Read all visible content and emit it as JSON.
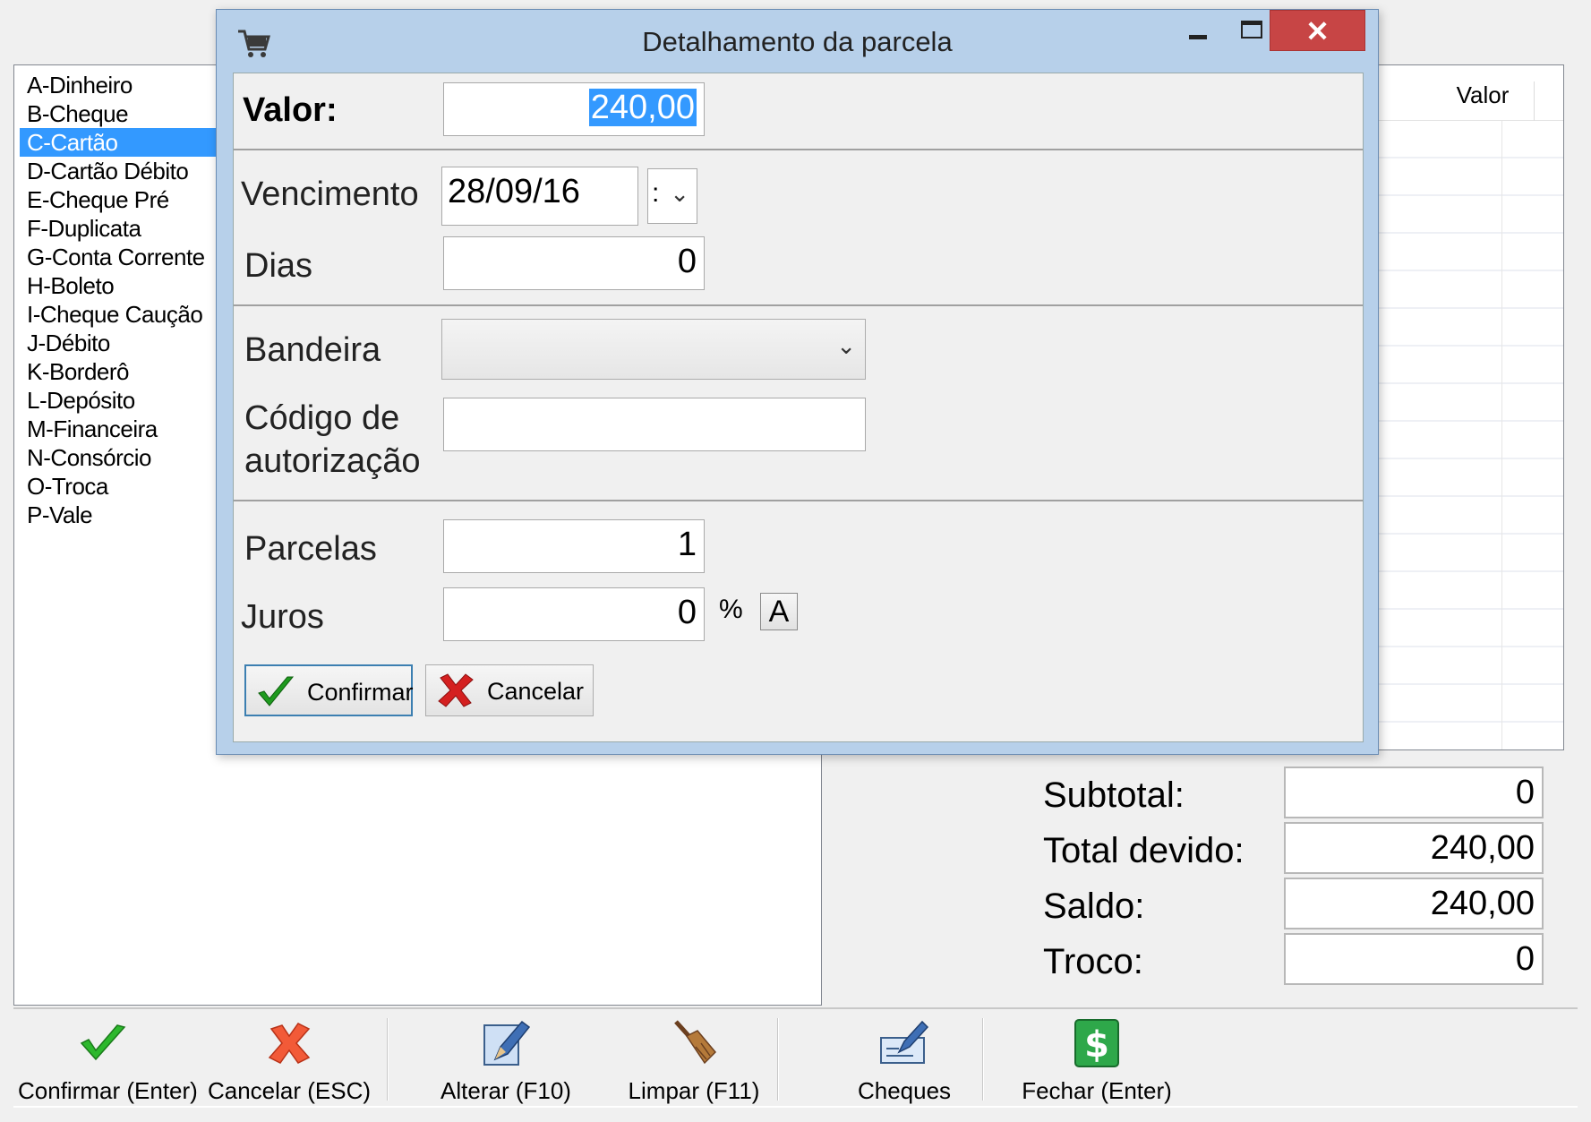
{
  "payment_methods": [
    "A-Dinheiro",
    "B-Cheque",
    "C-Cartão",
    "D-Cartão Débito",
    "E-Cheque Pré",
    "F-Duplicata",
    "G-Conta Corrente",
    "H-Boleto",
    "I-Cheque Caução",
    "J-Débito",
    "K-Borderô",
    "L-Depósito",
    "M-Financeira",
    "N-Consórcio",
    "O-Troca",
    "P-Vale"
  ],
  "selected_method_index": 2,
  "grid": {
    "col_valor": "Valor"
  },
  "totals": {
    "subtotal_label": "Subtotal:",
    "subtotal_value": "0",
    "total_label": "Total devido:",
    "total_value": "240,00",
    "saldo_label": "Saldo:",
    "saldo_value": "240,00",
    "troco_label": "Troco:",
    "troco_value": "0"
  },
  "toolbar": {
    "confirmar": "Confirmar (Enter)",
    "cancelar": "Cancelar (ESC)",
    "alterar": "Alterar (F10)",
    "limpar": "Limpar (F11)",
    "cheques": "Cheques",
    "fechar": "Fechar (Enter)"
  },
  "dialog": {
    "title": "Detalhamento da parcela",
    "close_glyph": "✕",
    "valor_label": "Valor:",
    "valor_value": "240,00",
    "vencimento_label": "Vencimento",
    "vencimento_value": "28/09/16",
    "dias_label": "Dias",
    "dias_value": "0",
    "bandeira_label": "Bandeira",
    "bandeira_value": "",
    "codigo_label_1": "Código de",
    "codigo_label_2": "autorização",
    "codigo_value": "",
    "parcelas_label": "Parcelas",
    "parcelas_value": "1",
    "juros_label": "Juros",
    "juros_value": "0",
    "percent": "%",
    "a_button": "A",
    "confirm_label": "Confirmar",
    "cancel_label": "Cancelar"
  },
  "colors": {
    "selection": "#3399ff",
    "close_button": "#c74545",
    "dialog_frame": "#b7d0ea"
  }
}
